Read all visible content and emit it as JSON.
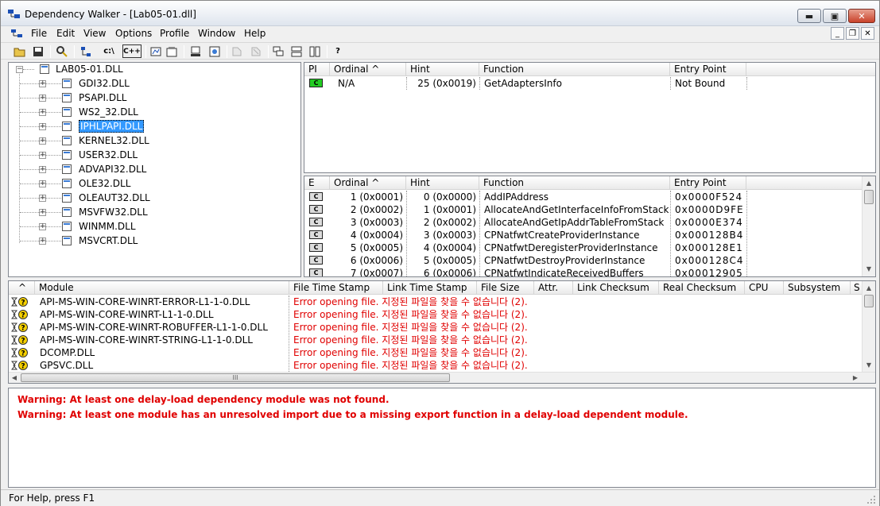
{
  "window": {
    "title": "Dependency Walker - [Lab05-01.dll]"
  },
  "window_controls": {
    "minimize": "▬",
    "maximize": "▣",
    "close": "✕"
  },
  "mdi_controls": {
    "minimize": "_",
    "restore": "❐",
    "close": "✕"
  },
  "menu": [
    "File",
    "Edit",
    "View",
    "Options",
    "Profile",
    "Window",
    "Help"
  ],
  "toolbar": {
    "c_drive": "c:\\",
    "cpp": "C++",
    "help": "?"
  },
  "tree": {
    "root": "LAB05-01.DLL",
    "children": [
      "GDI32.DLL",
      "PSAPI.DLL",
      "WS2_32.DLL",
      "IPHLPAPI.DLL",
      "KERNEL32.DLL",
      "USER32.DLL",
      "ADVAPI32.DLL",
      "OLE32.DLL",
      "OLEAUT32.DLL",
      "MSVFW32.DLL",
      "WINMM.DLL",
      "MSVCRT.DLL"
    ],
    "selected": "IPHLPAPI.DLL"
  },
  "imports": {
    "headers": [
      "PI",
      "Ordinal ^",
      "Hint",
      "Function",
      "Entry Point"
    ],
    "rows": [
      {
        "pi": "C",
        "ordinal": "N/A",
        "hint": "25 (0x0019)",
        "function": "GetAdaptersInfo",
        "entry": "Not Bound"
      }
    ]
  },
  "exports": {
    "headers": [
      "E",
      "Ordinal ^",
      "Hint",
      "Function",
      "Entry Point"
    ],
    "rows": [
      {
        "e": "C",
        "ordinal": "1 (0x0001)",
        "hint": "0 (0x0000)",
        "function": "AddIPAddress",
        "entry": "0x0000F524"
      },
      {
        "e": "C",
        "ordinal": "2 (0x0002)",
        "hint": "1 (0x0001)",
        "function": "AllocateAndGetInterfaceInfoFromStack",
        "entry": "0x0000D9FE"
      },
      {
        "e": "C",
        "ordinal": "3 (0x0003)",
        "hint": "2 (0x0002)",
        "function": "AllocateAndGetIpAddrTableFromStack",
        "entry": "0x0000E374"
      },
      {
        "e": "C",
        "ordinal": "4 (0x0004)",
        "hint": "3 (0x0003)",
        "function": "CPNatfwtCreateProviderInstance",
        "entry": "0x000128B4"
      },
      {
        "e": "C",
        "ordinal": "5 (0x0005)",
        "hint": "4 (0x0004)",
        "function": "CPNatfwtDeregisterProviderInstance",
        "entry": "0x000128E1"
      },
      {
        "e": "C",
        "ordinal": "6 (0x0006)",
        "hint": "5 (0x0005)",
        "function": "CPNatfwtDestroyProviderInstance",
        "entry": "0x000128C4"
      },
      {
        "e": "C",
        "ordinal": "7 (0x0007)",
        "hint": "6 (0x0006)",
        "function": "CPNatfwtIndicateReceivedBuffers",
        "entry": "0x00012905"
      }
    ]
  },
  "modules": {
    "headers": [
      "^",
      "Module",
      "File Time Stamp",
      "Link Time Stamp",
      "File Size",
      "Attr.",
      "Link Checksum",
      "Real Checksum",
      "CPU",
      "Subsystem",
      "S"
    ],
    "rows": [
      {
        "module": "API-MS-WIN-CORE-WINRT-ERROR-L1-1-0.DLL",
        "status": "Error opening file. 지정된 파일을 찾을 수 없습니다 (2)."
      },
      {
        "module": "API-MS-WIN-CORE-WINRT-L1-1-0.DLL",
        "status": "Error opening file. 지정된 파일을 찾을 수 없습니다 (2)."
      },
      {
        "module": "API-MS-WIN-CORE-WINRT-ROBUFFER-L1-1-0.DLL",
        "status": "Error opening file. 지정된 파일을 찾을 수 없습니다 (2)."
      },
      {
        "module": "API-MS-WIN-CORE-WINRT-STRING-L1-1-0.DLL",
        "status": "Error opening file. 지정된 파일을 찾을 수 없습니다 (2)."
      },
      {
        "module": "DCOMP.DLL",
        "status": "Error opening file. 지정된 파일을 찾을 수 없습니다 (2)."
      },
      {
        "module": "GPSVC.DLL",
        "status": "Error opening file. 지정된 파일을 찾을 수 없습니다 (2)."
      }
    ],
    "hscroll_grip": "III"
  },
  "log": [
    "Warning: At least one delay-load dependency module was not found.",
    "Warning: At least one module has an unresolved import due to a missing export function in a delay-load dependent module."
  ],
  "status": "For Help, press F1",
  "colors": {
    "error": "#e00000",
    "selection": "#3399ff",
    "pi_found": "#22cc22"
  }
}
